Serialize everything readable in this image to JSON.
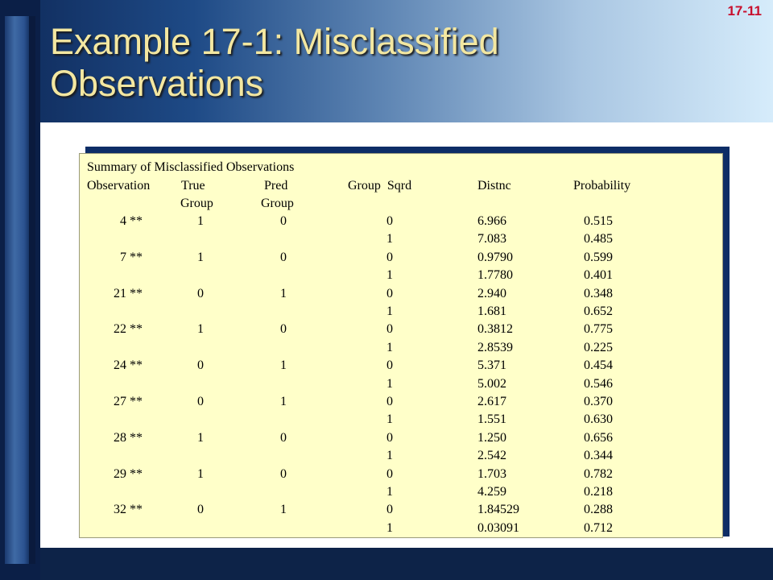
{
  "slide_number": "17-11",
  "title_line1": "Example 17-1: Misclassified",
  "title_line2": "Observations",
  "table": {
    "caption": "Summary of Misclassified Observations",
    "headers": {
      "observation": "Observation",
      "true": "True",
      "pred": "Pred",
      "group_sqrd": "Group  Sqrd",
      "distnc": "Distnc",
      "probability": "Probability",
      "true_group": "Group",
      "pred_group": "Group"
    },
    "rows": [
      {
        "obs": "4 **",
        "true": "1",
        "pred": "0",
        "group": "0",
        "distnc": "6.966",
        "prob": "0.515"
      },
      {
        "obs": "",
        "true": "",
        "pred": "",
        "group": "1",
        "distnc": "7.083",
        "prob": "0.485"
      },
      {
        "obs": "7 **",
        "true": "1",
        "pred": "0",
        "group": "0",
        "distnc": "0.9790",
        "prob": "0.599"
      },
      {
        "obs": "",
        "true": "",
        "pred": "",
        "group": "1",
        "distnc": "1.7780",
        "prob": "0.401"
      },
      {
        "obs": "21 **",
        "true": "0",
        "pred": "1",
        "group": "0",
        "distnc": "2.940",
        "prob": "0.348"
      },
      {
        "obs": "",
        "true": "",
        "pred": "",
        "group": "1",
        "distnc": "1.681",
        "prob": "0.652"
      },
      {
        "obs": "22 **",
        "true": "1",
        "pred": "0",
        "group": "0",
        "distnc": "0.3812",
        "prob": "0.775"
      },
      {
        "obs": "",
        "true": "",
        "pred": "",
        "group": "1",
        "distnc": "2.8539",
        "prob": "0.225"
      },
      {
        "obs": "24 **",
        "true": "0",
        "pred": "1",
        "group": "0",
        "distnc": "5.371",
        "prob": "0.454"
      },
      {
        "obs": "",
        "true": "",
        "pred": "",
        "group": "1",
        "distnc": "5.002",
        "prob": "0.546"
      },
      {
        "obs": "27 **",
        "true": "0",
        "pred": "1",
        "group": "0",
        "distnc": "2.617",
        "prob": "0.370"
      },
      {
        "obs": "",
        "true": "",
        "pred": "",
        "group": "1",
        "distnc": "1.551",
        "prob": "0.630"
      },
      {
        "obs": "28 **",
        "true": "1",
        "pred": "0",
        "group": "0",
        "distnc": "1.250",
        "prob": "0.656"
      },
      {
        "obs": "",
        "true": "",
        "pred": "",
        "group": "1",
        "distnc": "2.542",
        "prob": "0.344"
      },
      {
        "obs": "29 **",
        "true": "1",
        "pred": "0",
        "group": "0",
        "distnc": "1.703",
        "prob": "0.782"
      },
      {
        "obs": "",
        "true": "",
        "pred": "",
        "group": "1",
        "distnc": "4.259",
        "prob": "0.218"
      },
      {
        "obs": "32 **",
        "true": "0",
        "pred": "1",
        "group": "0",
        "distnc": "1.84529",
        "prob": "0.288"
      },
      {
        "obs": "",
        "true": "",
        "pred": "",
        "group": "1",
        "distnc": "0.03091",
        "prob": "0.712"
      }
    ]
  },
  "colors": {
    "title": "#f3e7a1",
    "slide_number": "#c8102e",
    "table_background": "#ffffc9",
    "frame": "#0d2348"
  }
}
